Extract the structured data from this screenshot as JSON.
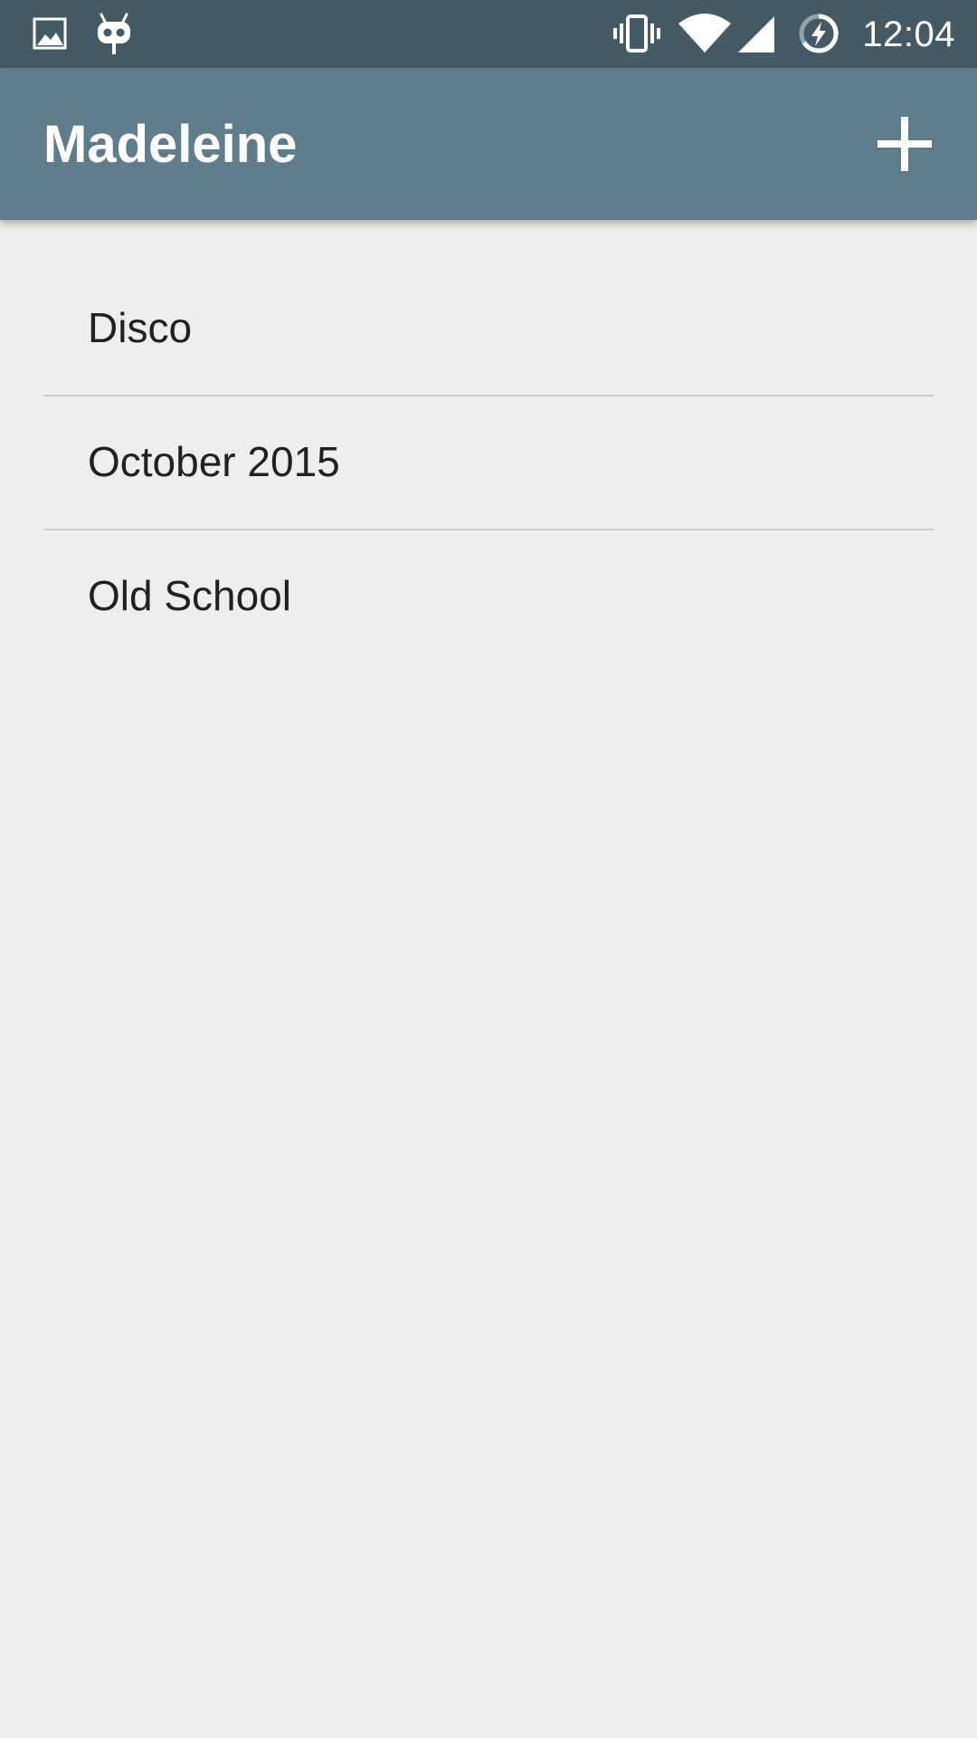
{
  "status_bar": {
    "time": "12:04",
    "notification_icons": [
      "image-icon",
      "cyanogenmod-icon"
    ],
    "system_icons": [
      "vibrate-icon",
      "wifi-icon",
      "signal-icon",
      "battery-charging-icon"
    ],
    "background_color": "#455a64"
  },
  "app_bar": {
    "title": "Madeleine",
    "action_icon": "add-icon",
    "background_color": "#607d8b"
  },
  "list": {
    "items": [
      {
        "label": "Disco"
      },
      {
        "label": "October 2015"
      },
      {
        "label": "Old School"
      }
    ]
  },
  "colors": {
    "background": "#eeeeee",
    "text_primary": "#212121",
    "divider": "#cfcfcf"
  }
}
